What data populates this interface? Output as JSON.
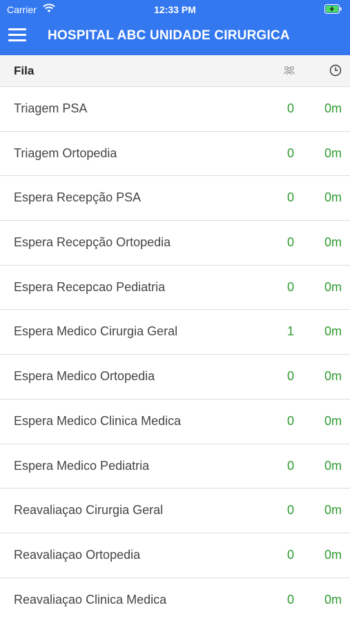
{
  "status_bar": {
    "carrier": "Carrier",
    "time": "12:33 PM"
  },
  "nav": {
    "title": "HOSPITAL ABC UNIDADE CIRURGICA",
    "menu_icon": "hamburger-menu-icon"
  },
  "header": {
    "label": "Fila",
    "count_icon": "people-icon",
    "time_icon": "clock-icon"
  },
  "colors": {
    "nav_background": "#3478f0",
    "value_green": "#2f9a2f"
  },
  "queues": [
    {
      "name": "Triagem PSA",
      "count": "0",
      "time": "0m"
    },
    {
      "name": "Triagem Ortopedia",
      "count": "0",
      "time": "0m"
    },
    {
      "name": "Espera Recepção PSA",
      "count": "0",
      "time": "0m"
    },
    {
      "name": "Espera Recepção Ortopedia",
      "count": "0",
      "time": "0m"
    },
    {
      "name": "Espera Recepcao Pediatria",
      "count": "0",
      "time": "0m"
    },
    {
      "name": "Espera Medico Cirurgia Geral",
      "count": "1",
      "time": "0m"
    },
    {
      "name": "Espera Medico Ortopedia",
      "count": "0",
      "time": "0m"
    },
    {
      "name": "Espera Medico Clinica Medica",
      "count": "0",
      "time": "0m"
    },
    {
      "name": "Espera Medico Pediatria",
      "count": "0",
      "time": "0m"
    },
    {
      "name": "Reavaliaçao Cirurgia Geral",
      "count": "0",
      "time": "0m"
    },
    {
      "name": "Reavaliaçao Ortopedia",
      "count": "0",
      "time": "0m"
    },
    {
      "name": "Reavaliaçao Clinica Medica",
      "count": "0",
      "time": "0m"
    }
  ]
}
